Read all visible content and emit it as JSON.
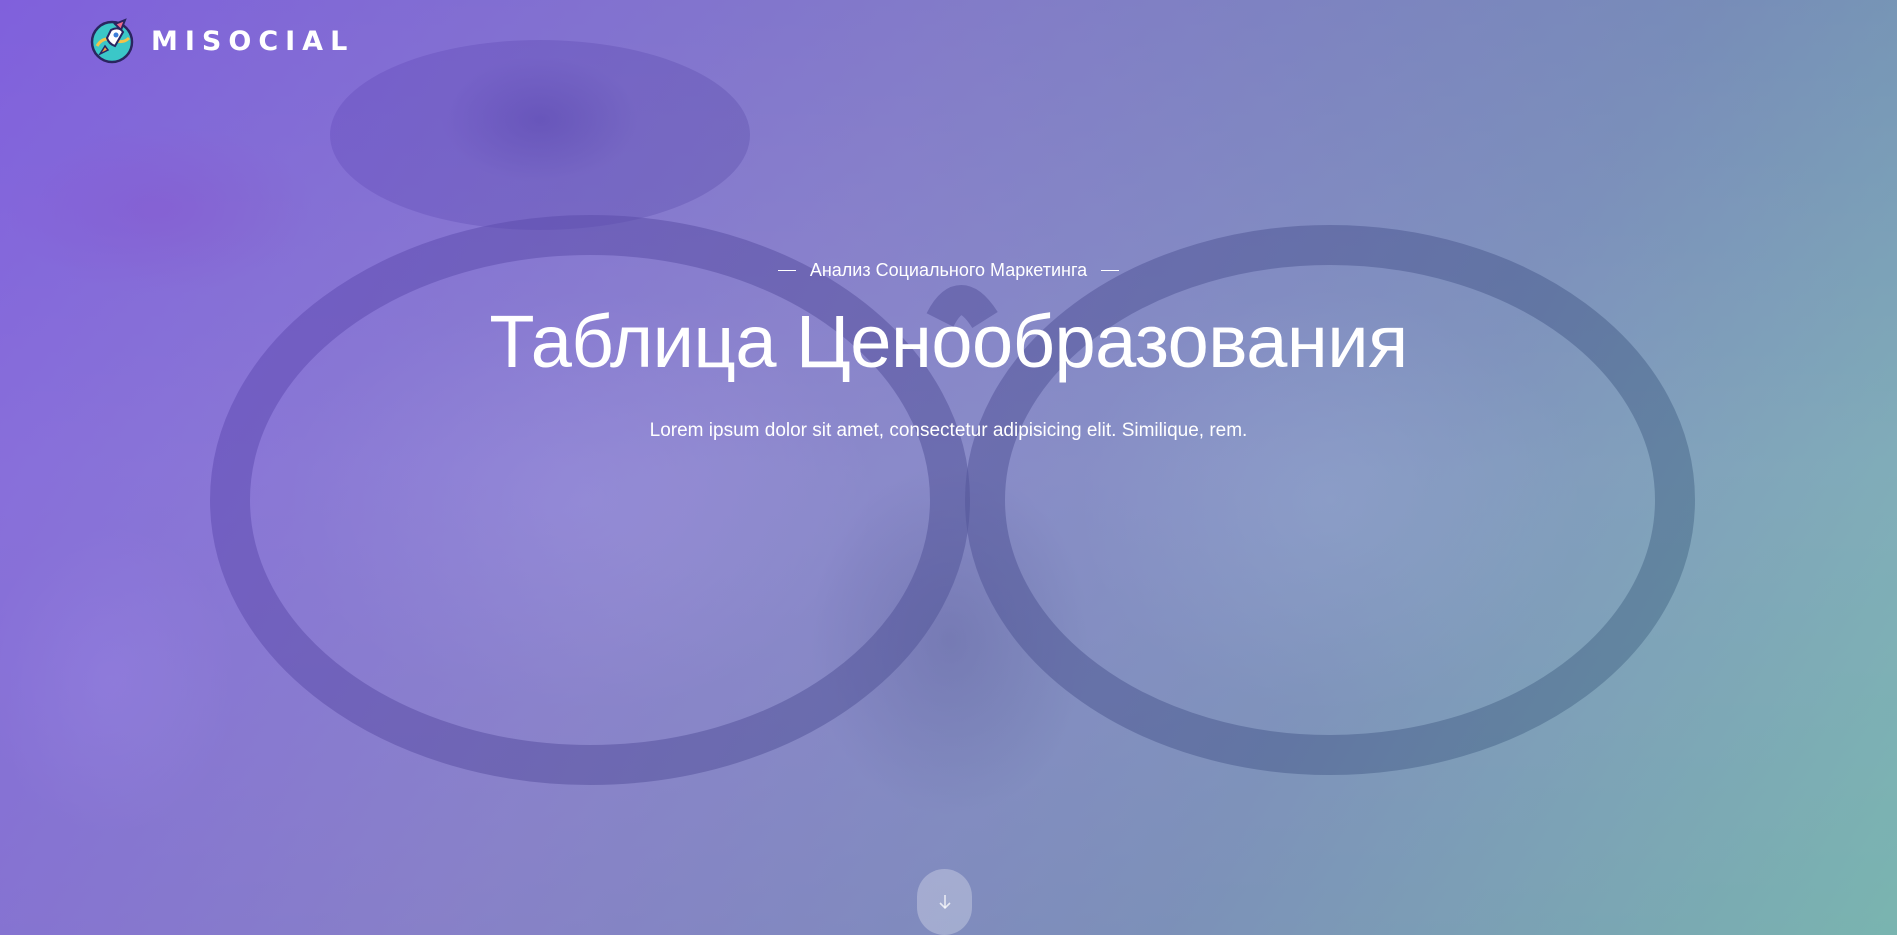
{
  "brand": {
    "name": "MISOCIAL",
    "logo_icon": "rocket-planet-icon"
  },
  "hero": {
    "eyebrow": "Анализ Социального Маркетинга",
    "title": "Таблица Ценообразования",
    "subtitle": "Lorem ipsum dolor sit amet, consectetur adipisicing elit. Similique, rem."
  },
  "scroll_button": {
    "icon": "arrow-down-icon"
  },
  "colors": {
    "overlay_start": "#7850e6",
    "overlay_end": "#5abeaa",
    "text": "#ffffff"
  }
}
